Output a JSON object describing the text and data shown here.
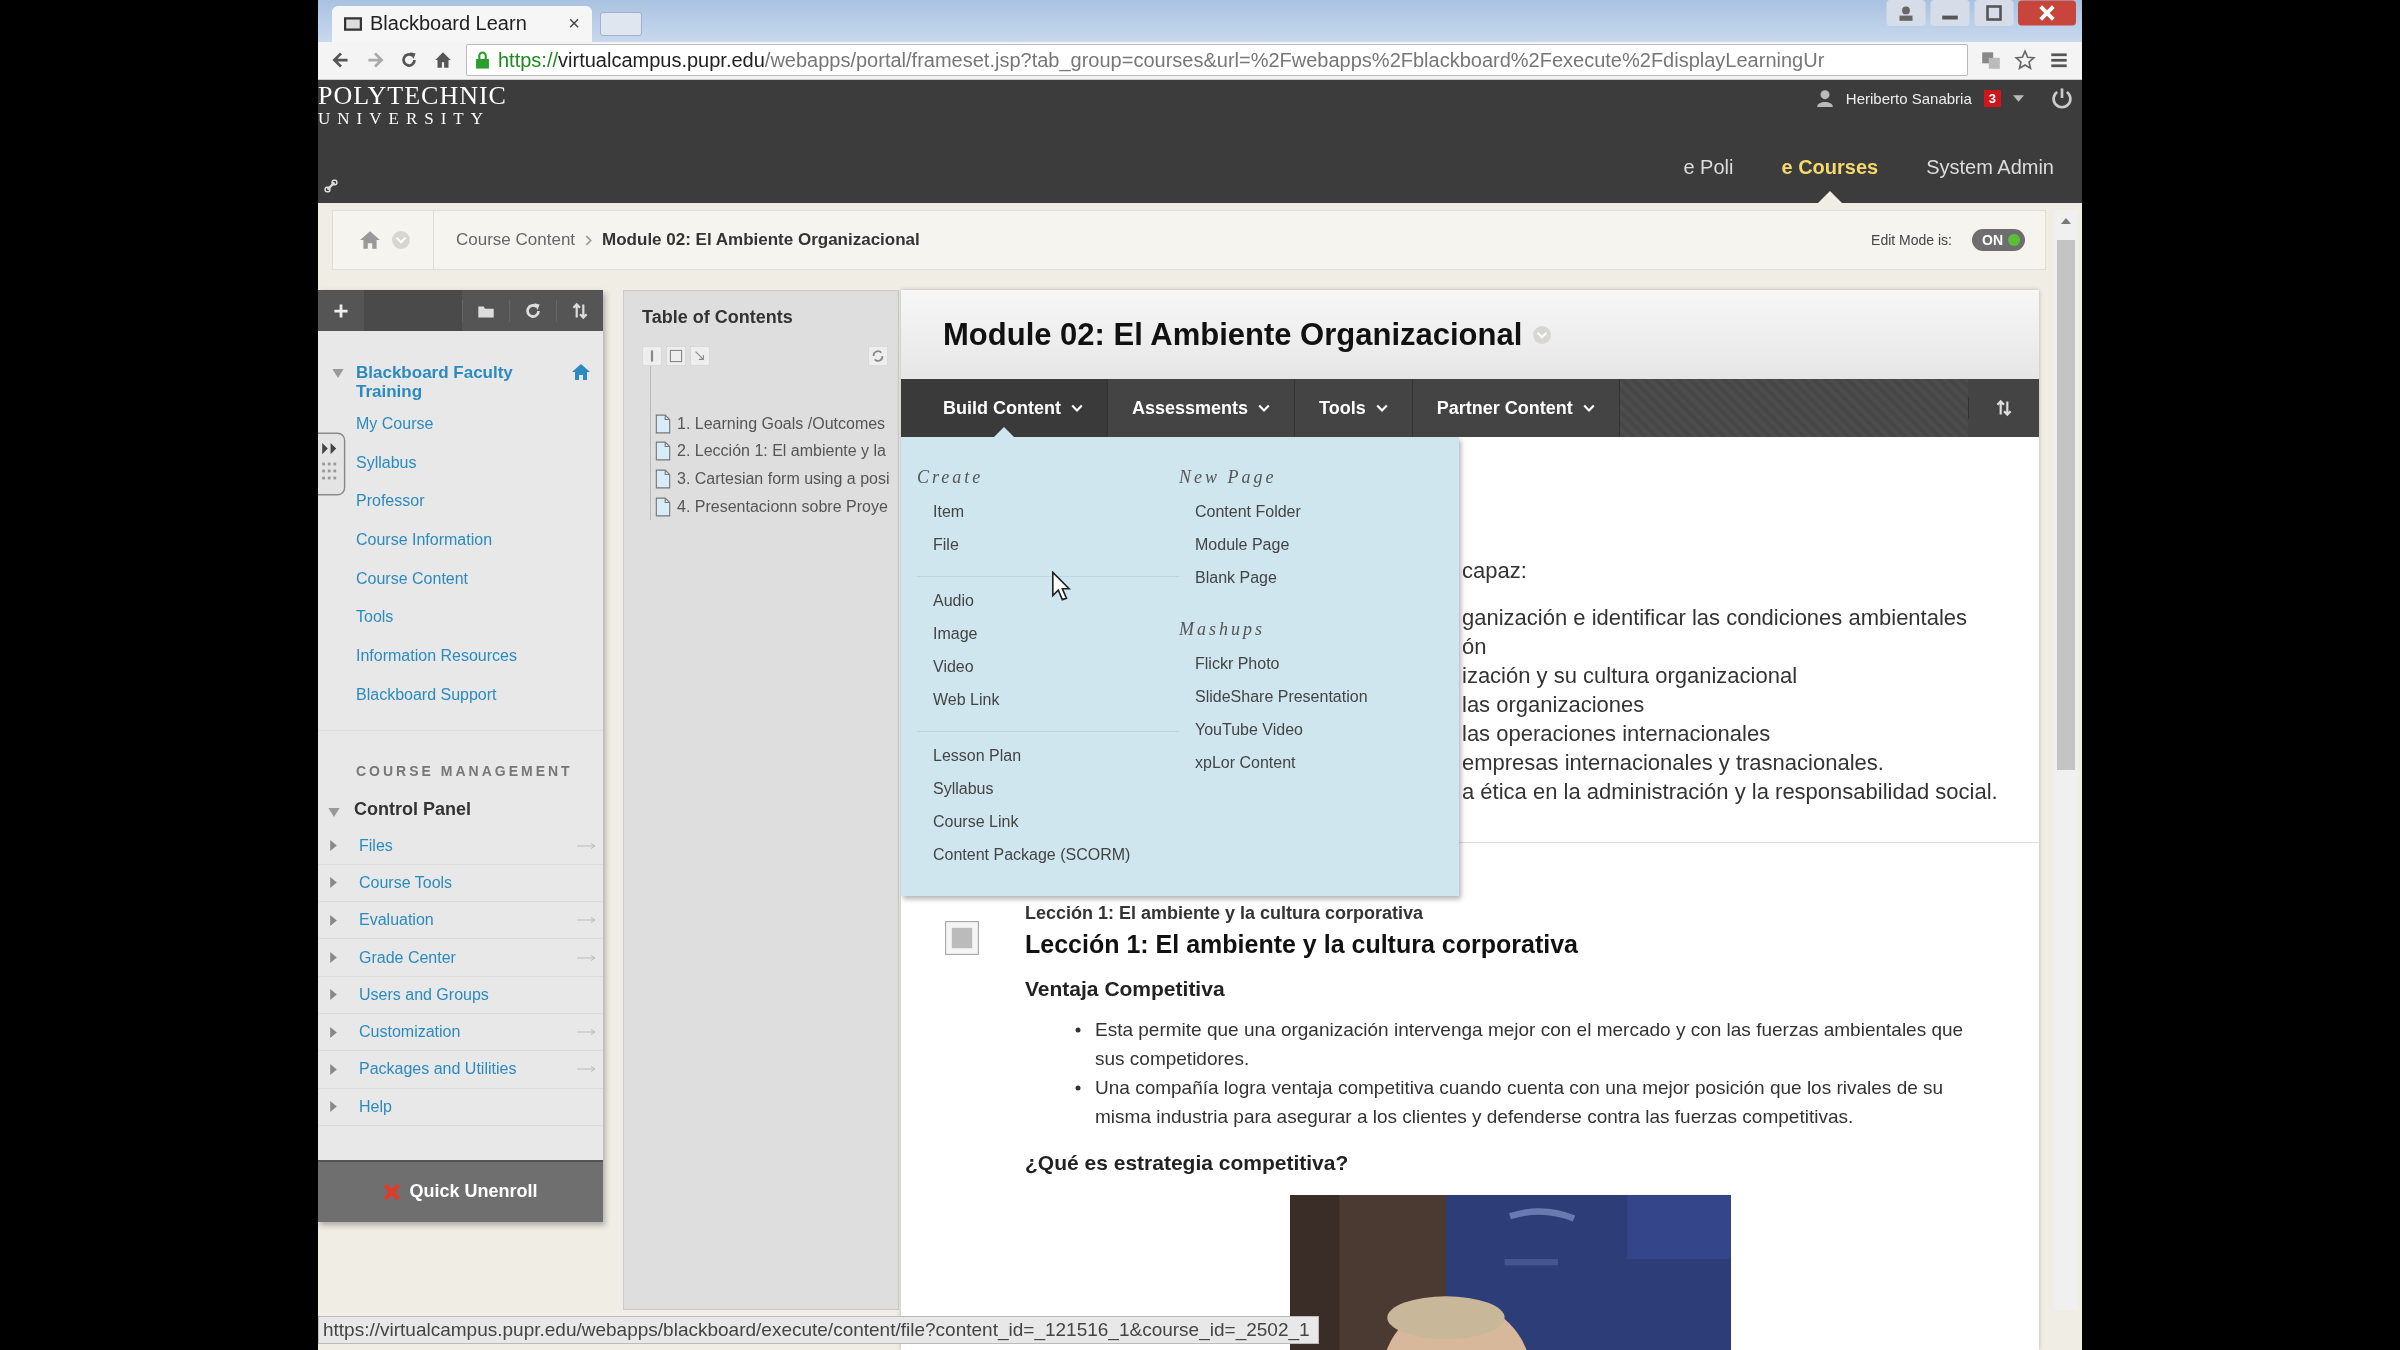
{
  "browser": {
    "tab_title": "Blackboard Learn",
    "tab_close": "×",
    "url_scheme": "https://",
    "url_host": "virtualcampus.pupr.edu",
    "url_path": "/webapps/portal/frameset.jsp?tab_group=courses&url=%2Fwebapps%2Fblackboard%2Fexecute%2FdisplayLearningUr"
  },
  "header": {
    "logo_line1": "POLYTECHNIC",
    "logo_line2": "UNIVERSITY",
    "user": "Heriberto Sanabria",
    "notifications": "3",
    "nav": [
      {
        "label": "e Poli",
        "selected": false
      },
      {
        "label": "e Courses",
        "selected": true
      },
      {
        "label": "System Admin",
        "selected": false
      }
    ]
  },
  "breadcrumb": {
    "items": [
      "Course Content",
      "Module 02: El Ambiente Organizacional"
    ],
    "edit_mode_label": "Edit Mode is:",
    "edit_mode": {
      "on": true,
      "label": "ON"
    }
  },
  "course_menu": {
    "course_title": "Blackboard Faculty Training",
    "links": [
      "My Course",
      "Syllabus",
      "Professor",
      "Course Information",
      "Course Content",
      "Tools",
      "Information Resources",
      "Blackboard Support"
    ],
    "management_heading": "COURSE MANAGEMENT",
    "control_panel": {
      "title": "Control Panel",
      "expanded": true,
      "items": [
        {
          "label": "Files",
          "has_arrow": true
        },
        {
          "label": "Course Tools",
          "has_arrow": false
        },
        {
          "label": "Evaluation",
          "has_arrow": true
        },
        {
          "label": "Grade Center",
          "has_arrow": true
        },
        {
          "label": "Users and Groups",
          "has_arrow": false
        },
        {
          "label": "Customization",
          "has_arrow": true
        },
        {
          "label": "Packages and Utilities",
          "has_arrow": true
        },
        {
          "label": "Help",
          "has_arrow": false
        }
      ]
    },
    "quick_unenroll": "Quick Unenroll"
  },
  "toc": {
    "title": "Table of Contents",
    "items": [
      "1. Learning Goals /Outcomes",
      "2. Lección 1: El ambiente y la",
      "3. Cartesian form using a posi",
      "4. Presentacionn sobre Proye"
    ]
  },
  "content": {
    "title": "Module 02: El Ambiente Organizacional",
    "action_bar": [
      {
        "label": "Build Content",
        "selected": true
      },
      {
        "label": "Assessments",
        "selected": false
      },
      {
        "label": "Tools",
        "selected": false
      },
      {
        "label": "Partner Content",
        "selected": false
      }
    ],
    "dropdown": {
      "columns": [
        [
          {
            "heading": "Create",
            "groups": [
              [
                "Item",
                "File"
              ],
              [
                "Audio",
                "Image",
                "Video",
                "Web Link"
              ],
              [
                "Lesson Plan",
                "Syllabus",
                "Course Link",
                "Content Package (SCORM)"
              ]
            ]
          }
        ],
        [
          {
            "heading": "New Page",
            "groups": [
              [
                "Content Folder",
                "Module Page",
                "Blank Page"
              ]
            ]
          },
          {
            "heading": "Mashups",
            "groups": [
              [
                "Flickr Photo",
                "SlideShare Presentation",
                "YouTube Video",
                "xpLor Content"
              ]
            ]
          }
        ]
      ]
    },
    "visible_lines": [
      "capaz:",
      "ganización e identificar las condiciones ambientales",
      "ón",
      "ización y su cultura organizacional",
      "las organizaciones",
      "las operaciones internacionales",
      "empresas internacionales y trasnacionales.",
      "a ética en la administración y la responsabilidad social."
    ],
    "item": {
      "small_title": "Lección 1: El ambiente y la cultura corporativa",
      "heading": "Lección 1: El ambiente y la cultura corporativa",
      "subheading": "Ventaja Competitiva",
      "bullets": [
        "Esta permite que una organización  intervenga mejor con el mercado y con las fuerzas ambientales  que sus competidores.",
        "Una compañía logra ventaja competitiva cuando cuenta con una mejor posición que los rivales de su misma industria para asegurar a los clientes y defenderse contra las fuerzas competitivas."
      ],
      "question": "¿Qué es estrategia competitiva?",
      "image": {
        "kind": "picture"
      }
    }
  },
  "status_url": "https://virtualcampus.pupr.edu/webapps/blackboard/execute/content/file?content_id=_121516_1&course_id=_2502_1"
}
